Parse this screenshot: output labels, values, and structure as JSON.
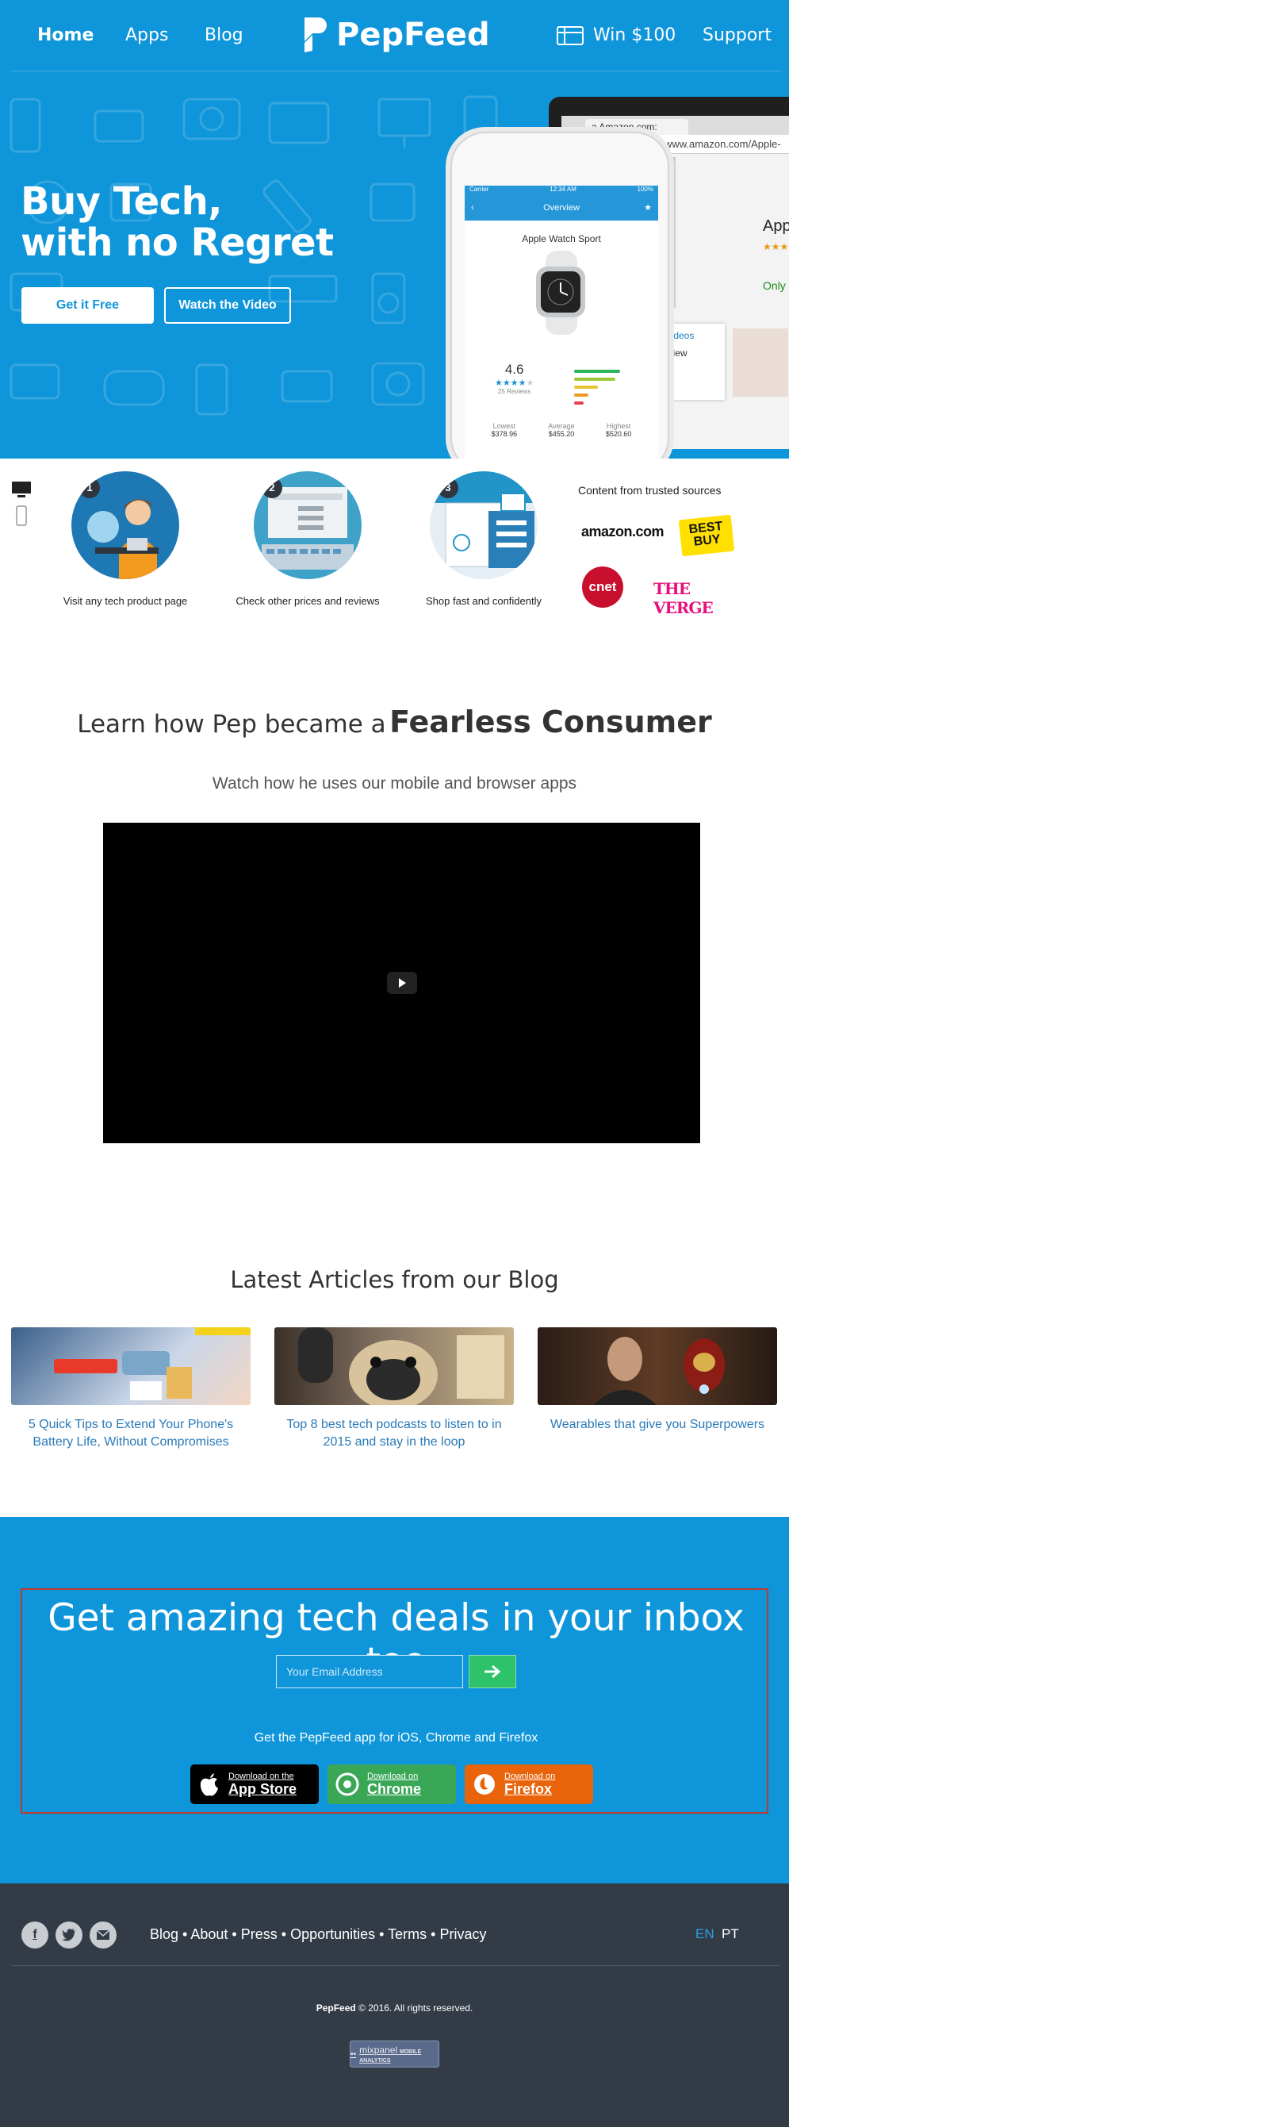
{
  "nav": {
    "home": "Home",
    "apps": "Apps",
    "blog": "Blog",
    "brand": "PepFeed",
    "win": "Win $100",
    "support": "Support"
  },
  "hero": {
    "title_line1": "Buy Tech,",
    "title_line2": "with no Regret",
    "cta_primary": "Get it Free",
    "cta_secondary": "Watch the Video",
    "browser_tab": "Amazon.com: Apple",
    "browser_url": "www.amazon.com/Apple-",
    "browser_product": "Apple",
    "browser_links": "ll videos",
    "browser_review": "review",
    "phone": {
      "carrier": "Carrier",
      "time": "12:34 AM",
      "battery": "100%",
      "screen_title": "Overview",
      "product": "Apple Watch Sport",
      "rating": "4.6",
      "reviews": "25 Reviews",
      "lowest_label": "Lowest",
      "lowest": "$378.96",
      "average_label": "Average",
      "average": "$455.20",
      "highest_label": "Highest",
      "highest": "$520.60"
    }
  },
  "steps": [
    {
      "num": "1",
      "caption": "Visit any tech product page"
    },
    {
      "num": "2",
      "caption": "Check other prices and reviews"
    },
    {
      "num": "3",
      "caption": "Shop fast and confidently"
    }
  ],
  "sources": {
    "label": "Content from trusted sources",
    "amazon": "amazon.com",
    "bestbuy_line1": "BEST",
    "bestbuy_line2": "BUY",
    "cnet": "cnet",
    "verge": "THE VERGE"
  },
  "learn": {
    "pre": "Learn how Pep became a",
    "strong": "Fearless Consumer",
    "subtitle": "Watch how he uses our mobile and browser apps"
  },
  "blog": {
    "title": "Latest Articles from our Blog",
    "articles": [
      {
        "title": "5 Quick Tips to Extend Your Phone's Battery Life, Without Compromises"
      },
      {
        "title": "Top 8 best tech podcasts to listen to in 2015 and stay in the loop"
      },
      {
        "title": "Wearables that give you Superpowers"
      }
    ]
  },
  "newsletter": {
    "title": "Get amazing tech deals in your inbox too",
    "placeholder": "Your Email Address",
    "get_app": "Get the PepFeed app for iOS, Chrome and Firefox",
    "stores": [
      {
        "small": "Download on the",
        "big": "App Store",
        "color": "#000000"
      },
      {
        "small": "Download on",
        "big": "Chrome",
        "color": "#3aa757"
      },
      {
        "small": "Download on",
        "big": "Firefox",
        "color": "#e8630a"
      }
    ]
  },
  "footer": {
    "links": [
      {
        "label": "Blog"
      },
      {
        "label": "About"
      },
      {
        "label": "Press"
      },
      {
        "label": "Opportunities"
      },
      {
        "label": "Terms"
      },
      {
        "label": "Privacy"
      }
    ],
    "lang_en": "EN",
    "lang_pt": "PT",
    "copyright_brand": "PepFeed",
    "copyright_rest": "© 2016. All rights reserved.",
    "mixpanel": "mixpanel",
    "mixpanel_sub": "MOBILE ANALYTICS"
  },
  "colors": {
    "primary": "#0f95d9",
    "footer": "#333b47",
    "accent_green": "#2ec26a",
    "link_blue": "#2a7ab8"
  }
}
